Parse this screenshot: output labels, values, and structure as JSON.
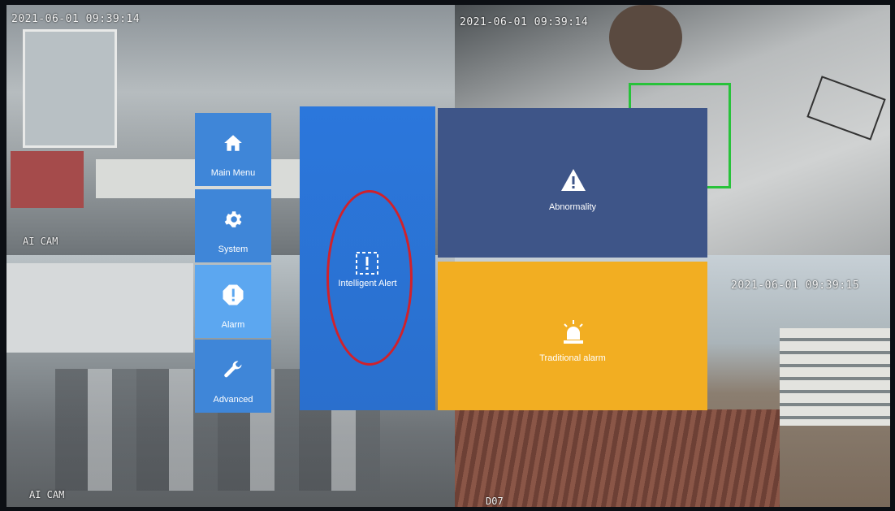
{
  "cameras": [
    {
      "timestamp": "2021-06-01 09:39:14",
      "label": "AI CAM"
    },
    {
      "timestamp": "2021-06-01 09:39:14",
      "label": ""
    },
    {
      "timestamp": "",
      "label": "AI CAM"
    },
    {
      "timestamp": "2021-06-01 09:39:15",
      "label": "D07"
    }
  ],
  "sidebar": {
    "items": [
      {
        "label": "Main Menu",
        "icon": "home-icon"
      },
      {
        "label": "System",
        "icon": "gear-icon"
      },
      {
        "label": "Alarm",
        "icon": "alert-icon",
        "active": true
      },
      {
        "label": "Advanced",
        "icon": "wrench-icon"
      }
    ]
  },
  "alarm_menu": {
    "intelligent_alert": {
      "label": "Intelligent Alert",
      "icon": "intelligent-alert-icon",
      "color": "#2b77dc"
    },
    "abnormality": {
      "label": "Abnormality",
      "icon": "warning-triangle-icon",
      "color": "#3e5588"
    },
    "traditional_alarm": {
      "label": "Traditional alarm",
      "icon": "siren-icon",
      "color": "#f2ae22"
    }
  },
  "annotation_color": "#d0212b"
}
